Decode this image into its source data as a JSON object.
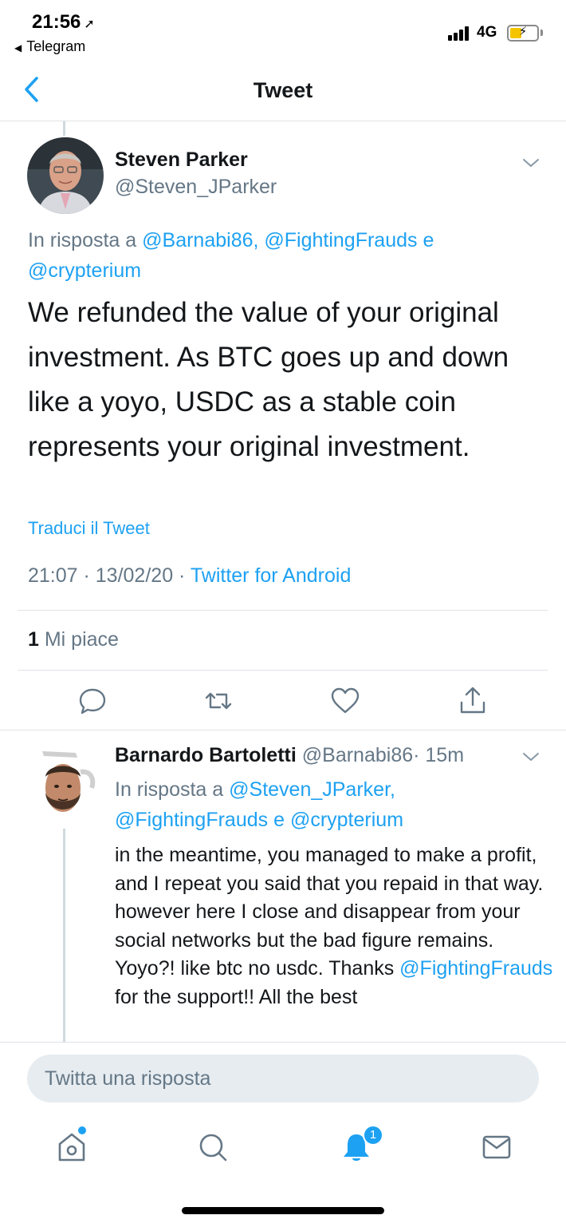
{
  "status_bar": {
    "time": "21:56",
    "back_app": "Telegram",
    "network": "4G"
  },
  "nav": {
    "title": "Tweet"
  },
  "main_tweet": {
    "author_name": "Steven Parker",
    "author_handle": "@Steven_JParker",
    "reply_prefix": "In risposta a",
    "reply_mentions_1": "@Barnabi86, @FightingFrauds",
    "reply_conj": "e",
    "reply_mentions_2": "@crypterium",
    "text": "We refunded the value of your original investment. As BTC goes up and down like a yoyo, USDC as a stable coin represents your original investment.",
    "translate_label": "Traduci il Tweet",
    "timestamp": "21:07 · 13/02/20 ·",
    "source": "Twitter for Android",
    "like_count": "1",
    "like_label": "Mi piace"
  },
  "reply_tweet": {
    "author_name": "Barnardo Bartoletti",
    "author_handle": "@Barnabi86",
    "time_ago": "· 15m",
    "reply_prefix": "In risposta a",
    "reply_mentions_1": "@Steven_JParker,",
    "reply_mentions_2": "@FightingFrauds",
    "reply_conj": "e",
    "reply_mentions_3": "@crypterium",
    "text_part1": "in the meantime, you managed to make a profit, and I repeat you said that you repaid in that way.  however here I close and disappear from your social networks but the bad figure remains. Yoyo?! like btc no usdc. Thanks ",
    "text_mention": "@FightingFrauds",
    "text_part2": " for the support!! All the best"
  },
  "composer": {
    "placeholder": "Twitta una risposta"
  },
  "tab_bar": {
    "notification_badge": "1"
  },
  "colors": {
    "accent": "#1da1f2",
    "text_primary": "#14171a",
    "text_secondary": "#657786",
    "divider": "#dfe3e7"
  }
}
